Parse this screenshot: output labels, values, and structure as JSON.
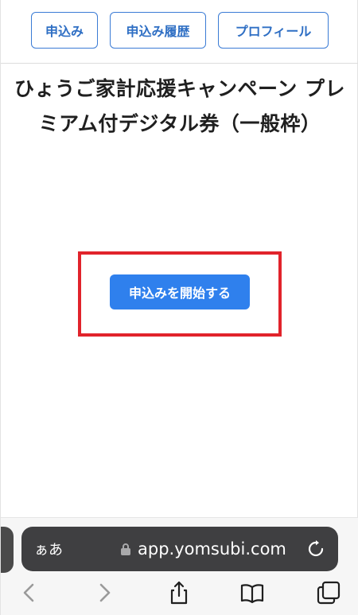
{
  "nav": {
    "items": [
      {
        "label": "申込み"
      },
      {
        "label": "申込み履歴"
      },
      {
        "label": "プロフィール"
      }
    ]
  },
  "page": {
    "title": "ひょうご家計応援キャンペーン プレミアム付デジタル券（一般枠）",
    "start_button": "申込みを開始する"
  },
  "browser": {
    "aa_label": "ぁあ",
    "url": "app.yomsubi.com"
  },
  "colors": {
    "accent": "#2f80ed",
    "nav_border": "#3a7bd5",
    "highlight": "#e1232b"
  },
  "icons": [
    "lock-icon",
    "reload-icon",
    "back-icon",
    "forward-icon",
    "share-icon",
    "bookmarks-icon",
    "tabs-icon"
  ]
}
